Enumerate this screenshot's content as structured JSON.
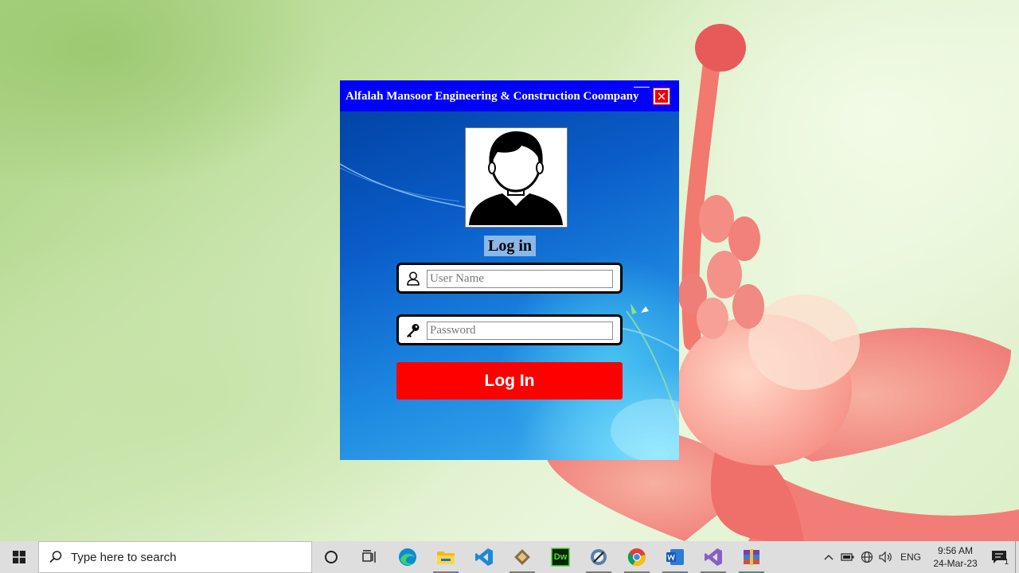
{
  "window": {
    "title": "Alfalah Mansoor Engineering & Construction Coompany",
    "heading": "Log in",
    "username_placeholder": "User Name",
    "username_value": "",
    "password_placeholder": "Password",
    "password_value": "",
    "login_button": "Log In",
    "colors": {
      "titlebar": "#0000ff",
      "login_button": "#ff0000",
      "close_button": "#ee0000"
    }
  },
  "taskbar": {
    "search_placeholder": "Type here to search",
    "pinned_apps": [
      "cortana-icon",
      "task-view-icon",
      "edge-icon",
      "file-explorer-icon",
      "vscode-icon",
      "git-icon",
      "dreamweaver-icon",
      "app-icon",
      "chrome-icon",
      "word-icon",
      "visual-studio-icon",
      "winrar-icon"
    ],
    "pinned_labels": {
      "dreamweaver": "Dw"
    },
    "tray": {
      "language": "ENG",
      "time": "9:56 AM",
      "date": "24-Mar-23",
      "notification_count": "1"
    }
  }
}
